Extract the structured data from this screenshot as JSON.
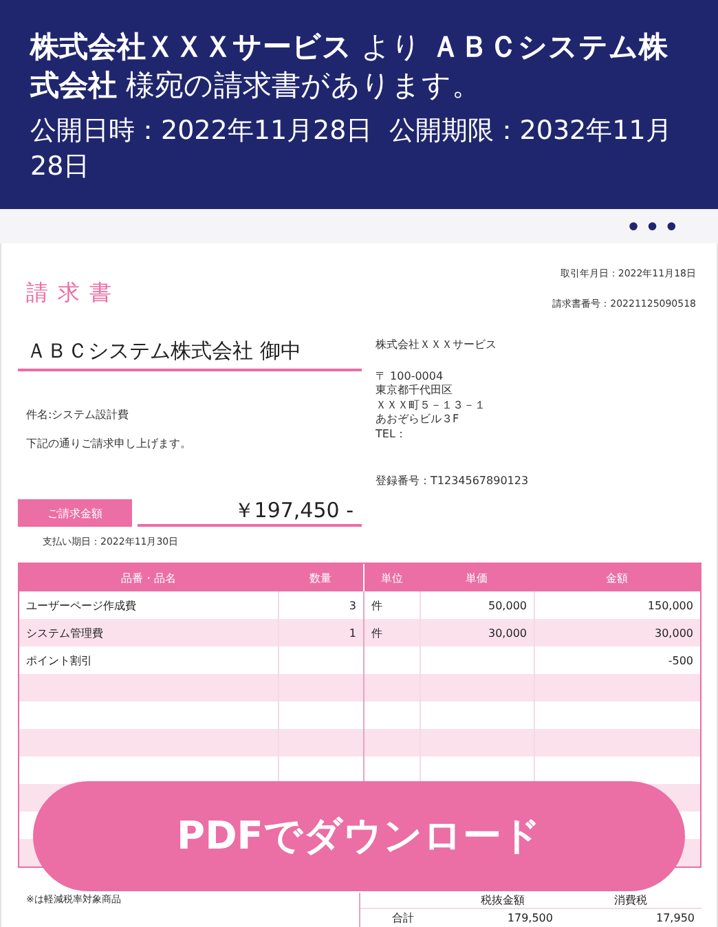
{
  "header": {
    "message": "**株式会社ＸＸＸサービス** より **ＡＢＣシステム株式会社** 様宛の請求書があります。",
    "dates": "公開日時：2022年11月28日  公開期限：2032年11月28日"
  },
  "toolbar": {
    "more_label": "•••"
  },
  "invoice": {
    "title": "請 求 書",
    "meta": [
      "取引年月日：2022年11月18日",
      "請求書番号：20221125090518"
    ],
    "recipient": "ＡＢＣシステム株式会社 御中",
    "subject": "件名:システム設計費",
    "greeting": "下記の通りご請求申し上げます。",
    "amount_label": "ご請求金額",
    "amount": "￥197,450 -",
    "due": "支払い期日：2022年11月30日",
    "issuer": {
      "name": "株式会社ＸＸＸサービス",
      "address": [
        "〒 100-0004",
        "東京都千代田区",
        "ＸＸＸ町５－１３－１",
        "あおぞらビル３F",
        "TEL："
      ],
      "registration": "登録番号：T1234567890123"
    },
    "table": {
      "columns": [
        "品番・品名",
        "数量",
        "単位",
        "単価",
        "金額"
      ],
      "rows": [
        {
          "cells": [
            "ユーザーページ作成費",
            "3",
            "件",
            "50,000",
            "150,000"
          ]
        },
        {
          "cells": [
            "システム管理費",
            "1",
            "件",
            "30,000",
            "30,000"
          ]
        },
        {
          "cells": [
            "ポイント割引",
            "",
            "",
            "",
            "-500"
          ]
        }
      ]
    },
    "note": "※は軽減税率対象商品",
    "summary": {
      "columns": [
        "税抜金額",
        "消費税"
      ],
      "total_label": "合計",
      "total_values": [
        "179,500",
        "17,950"
      ]
    }
  },
  "download_button": "PDFでダウンロード"
}
